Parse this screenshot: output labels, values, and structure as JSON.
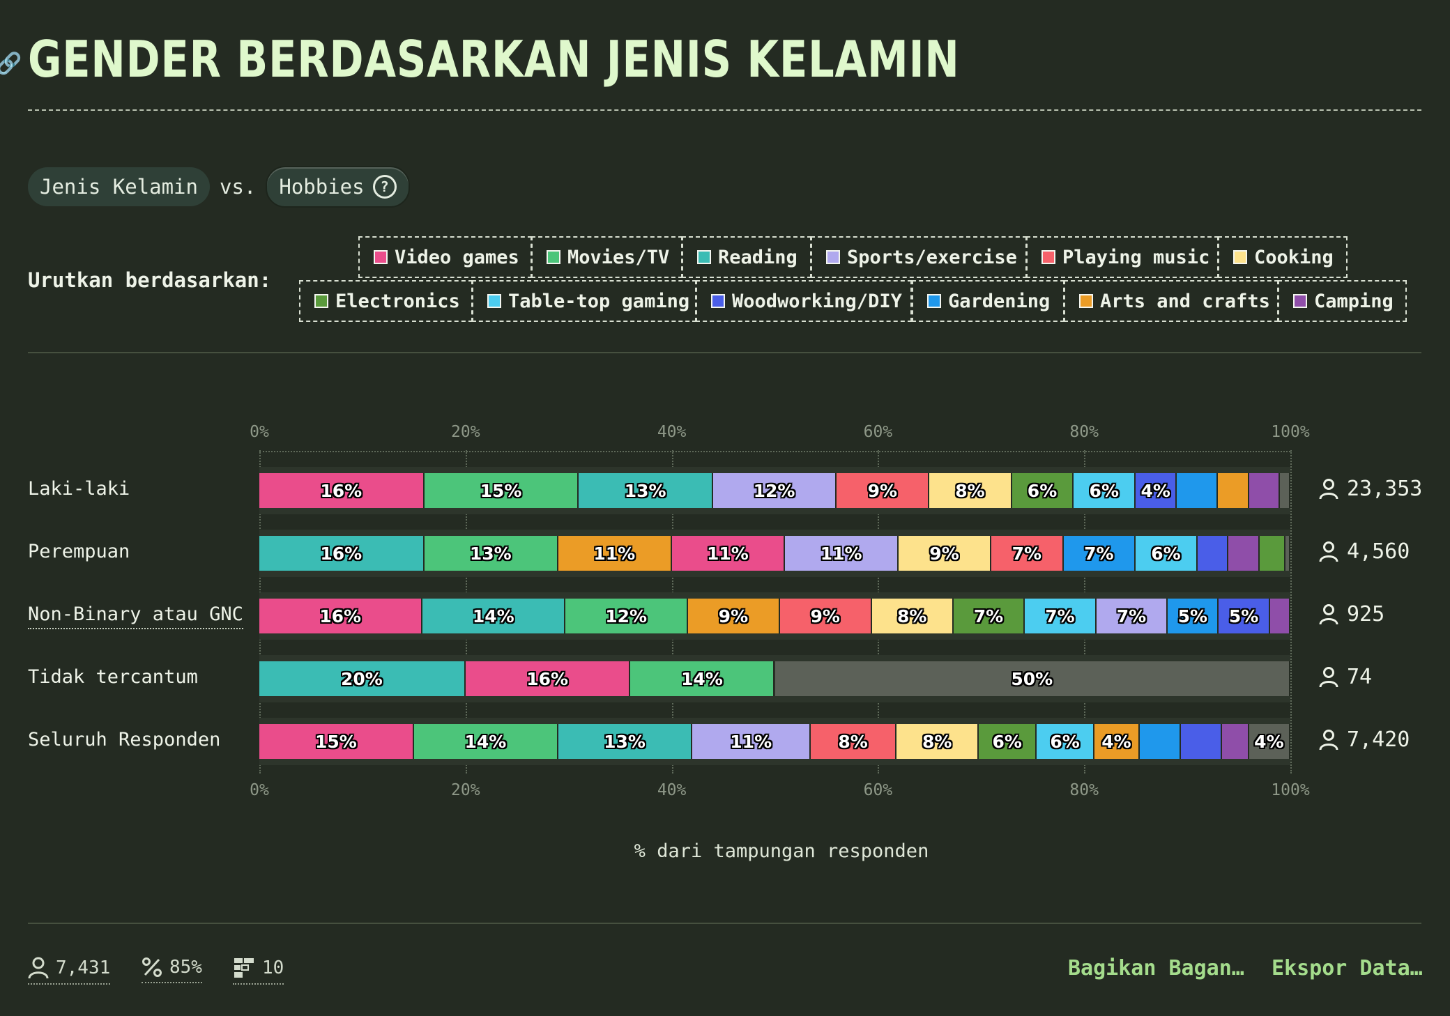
{
  "title": "GENDER BERDASARKAN JENIS KELAMIN",
  "compare": {
    "left": "Jenis Kelamin",
    "vs": "vs.",
    "right": "Hobbies"
  },
  "sort": {
    "label": "Urutkan berdasarkan:",
    "chips": [
      {
        "label": "Video games",
        "color": "#ea4d8b"
      },
      {
        "label": "Movies/TV",
        "color": "#4cc57a"
      },
      {
        "label": "Reading",
        "color": "#3bbcb4"
      },
      {
        "label": "Sports/exercise",
        "color": "#b0a9ee"
      },
      {
        "label": "Playing music",
        "color": "#f6616a"
      },
      {
        "label": "Cooking",
        "color": "#fde28c"
      },
      {
        "label": "Electronics",
        "color": "#5a9a3c"
      },
      {
        "label": "Table-top gaming",
        "color": "#4ccdf0"
      },
      {
        "label": "Woodworking/DIY",
        "color": "#4a5ee8"
      },
      {
        "label": "Gardening",
        "color": "#1f98ec"
      },
      {
        "label": "Arts and crafts",
        "color": "#eb9c26"
      },
      {
        "label": "Camping",
        "color": "#8f4ea9"
      }
    ]
  },
  "chart_data": {
    "type": "bar",
    "orientation": "horizontal",
    "stacked": true,
    "xlabel": "% dari tampungan responden",
    "xlim": [
      0,
      100
    ],
    "ticks": [
      "0%",
      "20%",
      "40%",
      "60%",
      "80%",
      "100%"
    ],
    "rows": [
      {
        "label": "Laki-laki",
        "count": "23,353",
        "segments": [
          {
            "name": "Video games",
            "value": 16,
            "label": "16%"
          },
          {
            "name": "Movies/TV",
            "value": 15,
            "label": "15%"
          },
          {
            "name": "Reading",
            "value": 13,
            "label": "13%"
          },
          {
            "name": "Sports/exercise",
            "value": 12,
            "label": "12%"
          },
          {
            "name": "Playing music",
            "value": 9,
            "label": "9%"
          },
          {
            "name": "Cooking",
            "value": 8,
            "label": "8%"
          },
          {
            "name": "Electronics",
            "value": 6,
            "label": "6%"
          },
          {
            "name": "Table-top gaming",
            "value": 6,
            "label": "6%"
          },
          {
            "name": "Woodworking/DIY",
            "value": 4,
            "label": "4%"
          },
          {
            "name": "Gardening",
            "value": 4,
            "label": ""
          },
          {
            "name": "Arts and crafts",
            "value": 3,
            "label": ""
          },
          {
            "name": "Camping",
            "value": 3,
            "label": ""
          },
          {
            "name": "Other",
            "value": 1,
            "label": ""
          }
        ]
      },
      {
        "label": "Perempuan",
        "count": "4,560",
        "segments": [
          {
            "name": "Reading",
            "value": 16,
            "label": "16%"
          },
          {
            "name": "Movies/TV",
            "value": 13,
            "label": "13%"
          },
          {
            "name": "Arts and crafts",
            "value": 11,
            "label": "11%"
          },
          {
            "name": "Video games",
            "value": 11,
            "label": "11%"
          },
          {
            "name": "Sports/exercise",
            "value": 11,
            "label": "11%"
          },
          {
            "name": "Cooking",
            "value": 9,
            "label": "9%"
          },
          {
            "name": "Playing music",
            "value": 7,
            "label": "7%"
          },
          {
            "name": "Gardening",
            "value": 7,
            "label": "7%"
          },
          {
            "name": "Table-top gaming",
            "value": 6,
            "label": "6%"
          },
          {
            "name": "Woodworking/DIY",
            "value": 3,
            "label": ""
          },
          {
            "name": "Camping",
            "value": 3,
            "label": ""
          },
          {
            "name": "Electronics",
            "value": 2.5,
            "label": ""
          },
          {
            "name": "Other",
            "value": 0.5,
            "label": ""
          }
        ]
      },
      {
        "label": "Non-Binary atau GNC",
        "count": "925",
        "segments": [
          {
            "name": "Video games",
            "value": 16,
            "label": "16%"
          },
          {
            "name": "Reading",
            "value": 14,
            "label": "14%"
          },
          {
            "name": "Movies/TV",
            "value": 12,
            "label": "12%"
          },
          {
            "name": "Arts and crafts",
            "value": 9,
            "label": "9%"
          },
          {
            "name": "Playing music",
            "value": 9,
            "label": "9%"
          },
          {
            "name": "Cooking",
            "value": 8,
            "label": "8%"
          },
          {
            "name": "Electronics",
            "value": 7,
            "label": "7%"
          },
          {
            "name": "Table-top gaming",
            "value": 7,
            "label": "7%"
          },
          {
            "name": "Sports/exercise",
            "value": 7,
            "label": "7%"
          },
          {
            "name": "Gardening",
            "value": 5,
            "label": "5%"
          },
          {
            "name": "Woodworking/DIY",
            "value": 5,
            "label": "5%"
          },
          {
            "name": "Camping",
            "value": 2,
            "label": ""
          }
        ]
      },
      {
        "label": "Tidak tercantum",
        "count": "74",
        "segments": [
          {
            "name": "Reading",
            "value": 20,
            "label": "20%"
          },
          {
            "name": "Video games",
            "value": 16,
            "label": "16%"
          },
          {
            "name": "Movies/TV",
            "value": 14,
            "label": "14%"
          },
          {
            "name": "Other",
            "value": 50,
            "label": "50%"
          }
        ]
      },
      {
        "label": "Seluruh Responden",
        "count": "7,420",
        "segments": [
          {
            "name": "Video games",
            "value": 15,
            "label": "15%"
          },
          {
            "name": "Movies/TV",
            "value": 14,
            "label": "14%"
          },
          {
            "name": "Reading",
            "value": 13,
            "label": "13%"
          },
          {
            "name": "Sports/exercise",
            "value": 11.5,
            "label": "11%"
          },
          {
            "name": "Playing music",
            "value": 8.3,
            "label": "8%"
          },
          {
            "name": "Cooking",
            "value": 8,
            "label": "8%"
          },
          {
            "name": "Electronics",
            "value": 5.6,
            "label": "6%"
          },
          {
            "name": "Table-top gaming",
            "value": 5.6,
            "label": "6%"
          },
          {
            "name": "Arts and crafts",
            "value": 4.4,
            "label": "4%"
          },
          {
            "name": "Gardening",
            "value": 4,
            "label": ""
          },
          {
            "name": "Woodworking/DIY",
            "value": 4,
            "label": ""
          },
          {
            "name": "Camping",
            "value": 2.6,
            "label": ""
          },
          {
            "name": "Other",
            "value": 4,
            "label": "4%"
          }
        ]
      }
    ]
  },
  "colors": {
    "Video games": "#ea4d8b",
    "Movies/TV": "#4cc57a",
    "Reading": "#3bbcb4",
    "Sports/exercise": "#b0a9ee",
    "Playing music": "#f6616a",
    "Cooking": "#fde28c",
    "Electronics": "#5a9a3c",
    "Table-top gaming": "#4ccdf0",
    "Woodworking/DIY": "#4a5ee8",
    "Gardening": "#1f98ec",
    "Arts and crafts": "#eb9c26",
    "Camping": "#8f4ea9",
    "Other": "#5c6158"
  },
  "footer": {
    "respondents": "7,431",
    "percent": "85%",
    "count": "10",
    "share": "Bagikan Bagan…",
    "export": "Ekspor Data…"
  }
}
